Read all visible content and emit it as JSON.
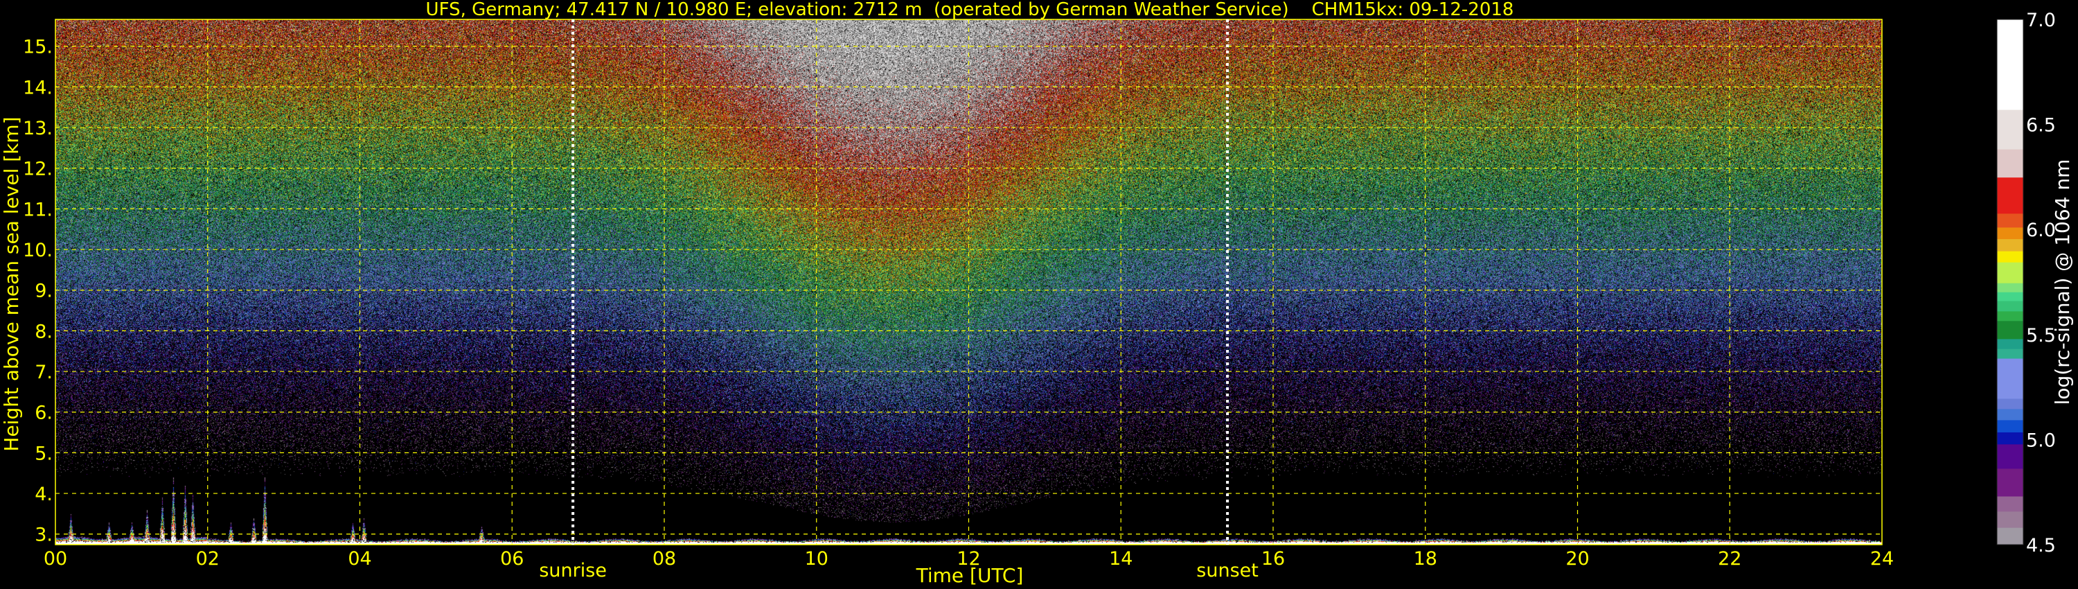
{
  "chart_data": {
    "type": "heatmap",
    "title": "UFS, Germany; 47.417 N / 10.980 E; elevation: 2712 m  (operated by German Weather Service)    CHM15kx: 09-12-2018",
    "xlabel": "Time [UTC]",
    "ylabel": "Height above mean sea level [km]",
    "xlim": [
      0,
      24
    ],
    "ylim": [
      2.74,
      15.66
    ],
    "x_ticks": [
      "00",
      "02",
      "04",
      "06",
      "08",
      "10",
      "12",
      "14",
      "16",
      "18",
      "20",
      "22",
      "24"
    ],
    "x_tick_values": [
      0,
      2,
      4,
      6,
      8,
      10,
      12,
      14,
      16,
      18,
      20,
      22,
      24
    ],
    "y_ticks": [
      "3.",
      "4.",
      "5.",
      "6.",
      "7.",
      "8.",
      "9.",
      "10.",
      "11.",
      "12.",
      "13.",
      "14.",
      "15."
    ],
    "y_tick_values": [
      3,
      4,
      5,
      6,
      7,
      8,
      9,
      10,
      11,
      12,
      13,
      14,
      15
    ],
    "grid": true,
    "grid_color": "#ffff00",
    "text_color": "#ffff00",
    "annotations": [
      {
        "label": "sunrise",
        "time": 6.8
      },
      {
        "label": "sunset",
        "time": 15.4
      }
    ],
    "colorbar": {
      "label": "log(rc-signal) @ 1064 nm",
      "range": [
        4.5,
        7.0
      ],
      "ticks": [
        "4.5",
        "5.0",
        "5.5",
        "6.0",
        "6.5",
        "7.0"
      ],
      "tick_values": [
        4.5,
        5.0,
        5.5,
        6.0,
        6.5,
        7.0
      ],
      "boundaries": [
        4.5,
        4.582,
        4.659,
        4.731,
        4.863,
        4.979,
        5.036,
        5.094,
        5.147,
        5.196,
        5.387,
        5.433,
        5.48,
        5.566,
        5.612,
        5.661,
        5.703,
        5.746,
        5.845,
        5.898,
        5.956,
        6.011,
        6.077,
        6.249,
        6.383,
        6.571,
        7.0
      ],
      "colors": [
        "#a09aa4",
        "#9a7c98",
        "#946494",
        "#741c84",
        "#560890",
        "#0a14b0",
        "#1050d0",
        "#4476d6",
        "#6a7ed8",
        "#8090e8",
        "#30b090",
        "#1fa08a",
        "#1a8a32",
        "#2eae4a",
        "#36c276",
        "#44d68a",
        "#7ee27a",
        "#bcf050",
        "#f8ec00",
        "#e8b428",
        "#ec8c0e",
        "#e6541f",
        "#e41e1a",
        "#e0c8c8",
        "#e8e0de",
        "#ffffff"
      ]
    },
    "description_values": {
      "ground_layer_top_km": 2.95,
      "daytime_solar_background": [
        8.5,
        14.5
      ]
    }
  }
}
